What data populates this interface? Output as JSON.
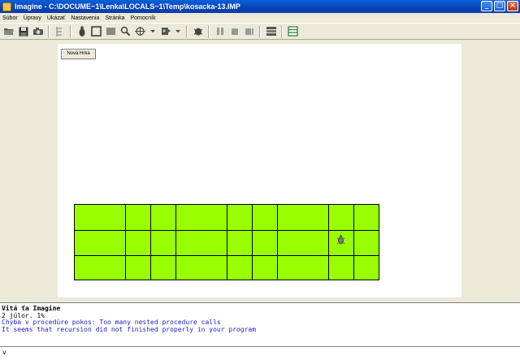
{
  "window": {
    "title": "Imagine - C:\\DOCUME~1\\Lenka\\LOCALS~1\\Temp\\kosacka-13.IMP",
    "buttons": {
      "minimize": "_",
      "maximize": "□",
      "close": "×"
    }
  },
  "menu": {
    "items": [
      "Súbor",
      "Úpravy",
      "Ukázať",
      "Nastavenia",
      "Stránka",
      "Pomocník"
    ]
  },
  "toolbar": {
    "icons": [
      "open-folder-icon",
      "save-icon",
      "camera-icon",
      "step-icon",
      "turtle-tool-icon",
      "frame-tool-icon",
      "rectangle-tool-icon",
      "magnifier-tool-icon",
      "compass-tool-icon",
      "paint-tool-icon",
      "debug-icon",
      "pause-icon",
      "stop-icon",
      "stop-all-icon",
      "layers-icon",
      "grid-icon"
    ]
  },
  "page": {
    "new_page_button": "Nová Hrka"
  },
  "console": {
    "lines": [
      "Vitá ťa Imagine",
      "2 júlor. 1%",
      "Chyba v procedúre pokos: Too many nested procedure calls",
      " It seems that recursion did not finished properly in your program"
    ]
  },
  "command_line": {
    "value": "v"
  },
  "colors": {
    "board_fill": "#99ff00",
    "error_text": "#2020c8",
    "titlebar": "#0843b8"
  }
}
